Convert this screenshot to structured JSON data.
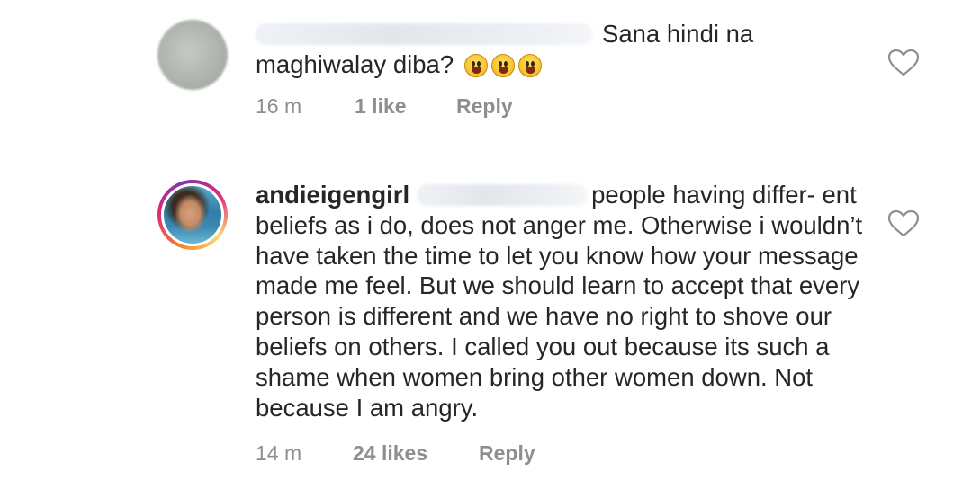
{
  "comments": [
    {
      "username": "",
      "text_line1": "Sana hindi na",
      "text_line2": "maghiwalay diba?",
      "emoji_count": 3,
      "time": "16 m",
      "likes": "1 like",
      "reply_label": "Reply"
    },
    {
      "username": "andieigengirl",
      "text_start": "people having differ-",
      "text_rest": "ent beliefs as i do, does not anger me. Otherwise i wouldn’t have taken the time to let you know how your message made me feel. But we should learn to accept that every person is different and we have no right to shove our beliefs on others. I called you out because its such a shame when women bring other women down. Not because I am angry.",
      "time": "14 m",
      "likes": "24 likes",
      "reply_label": "Reply"
    }
  ],
  "icons": {
    "like": "heart-outline-icon",
    "emoji": "grinning-face-emoji"
  },
  "colors": {
    "text": "#262626",
    "meta": "#8e8e8e",
    "heart_stroke": "#8e8e8e"
  }
}
